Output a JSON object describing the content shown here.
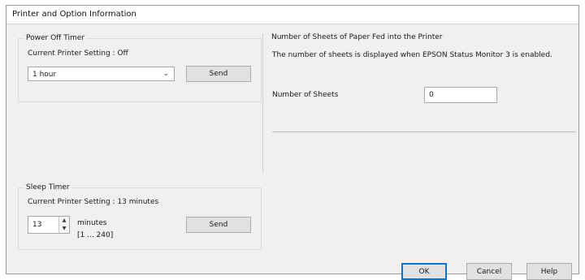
{
  "window": {
    "title": "Printer and Option Information"
  },
  "power_off": {
    "group_label": "Power Off Timer",
    "current_setting": "Current Printer Setting : Off",
    "selected_option": "1 hour",
    "send_label": "Send"
  },
  "sheets": {
    "group_label": "Number of Sheets of Paper Fed into the Printer",
    "description": "The number of sheets is displayed when EPSON Status Monitor 3 is enabled.",
    "field_label": "Number of Sheets",
    "field_value": "0"
  },
  "sleep": {
    "group_label": "Sleep Timer",
    "current_setting": "Current Printer Setting : 13 minutes",
    "value": "13",
    "unit": "minutes",
    "range": "[1 ... 240]",
    "send_label": "Send"
  },
  "footer": {
    "ok_label": "OK",
    "cancel_label": "Cancel",
    "help_label": "Help"
  }
}
